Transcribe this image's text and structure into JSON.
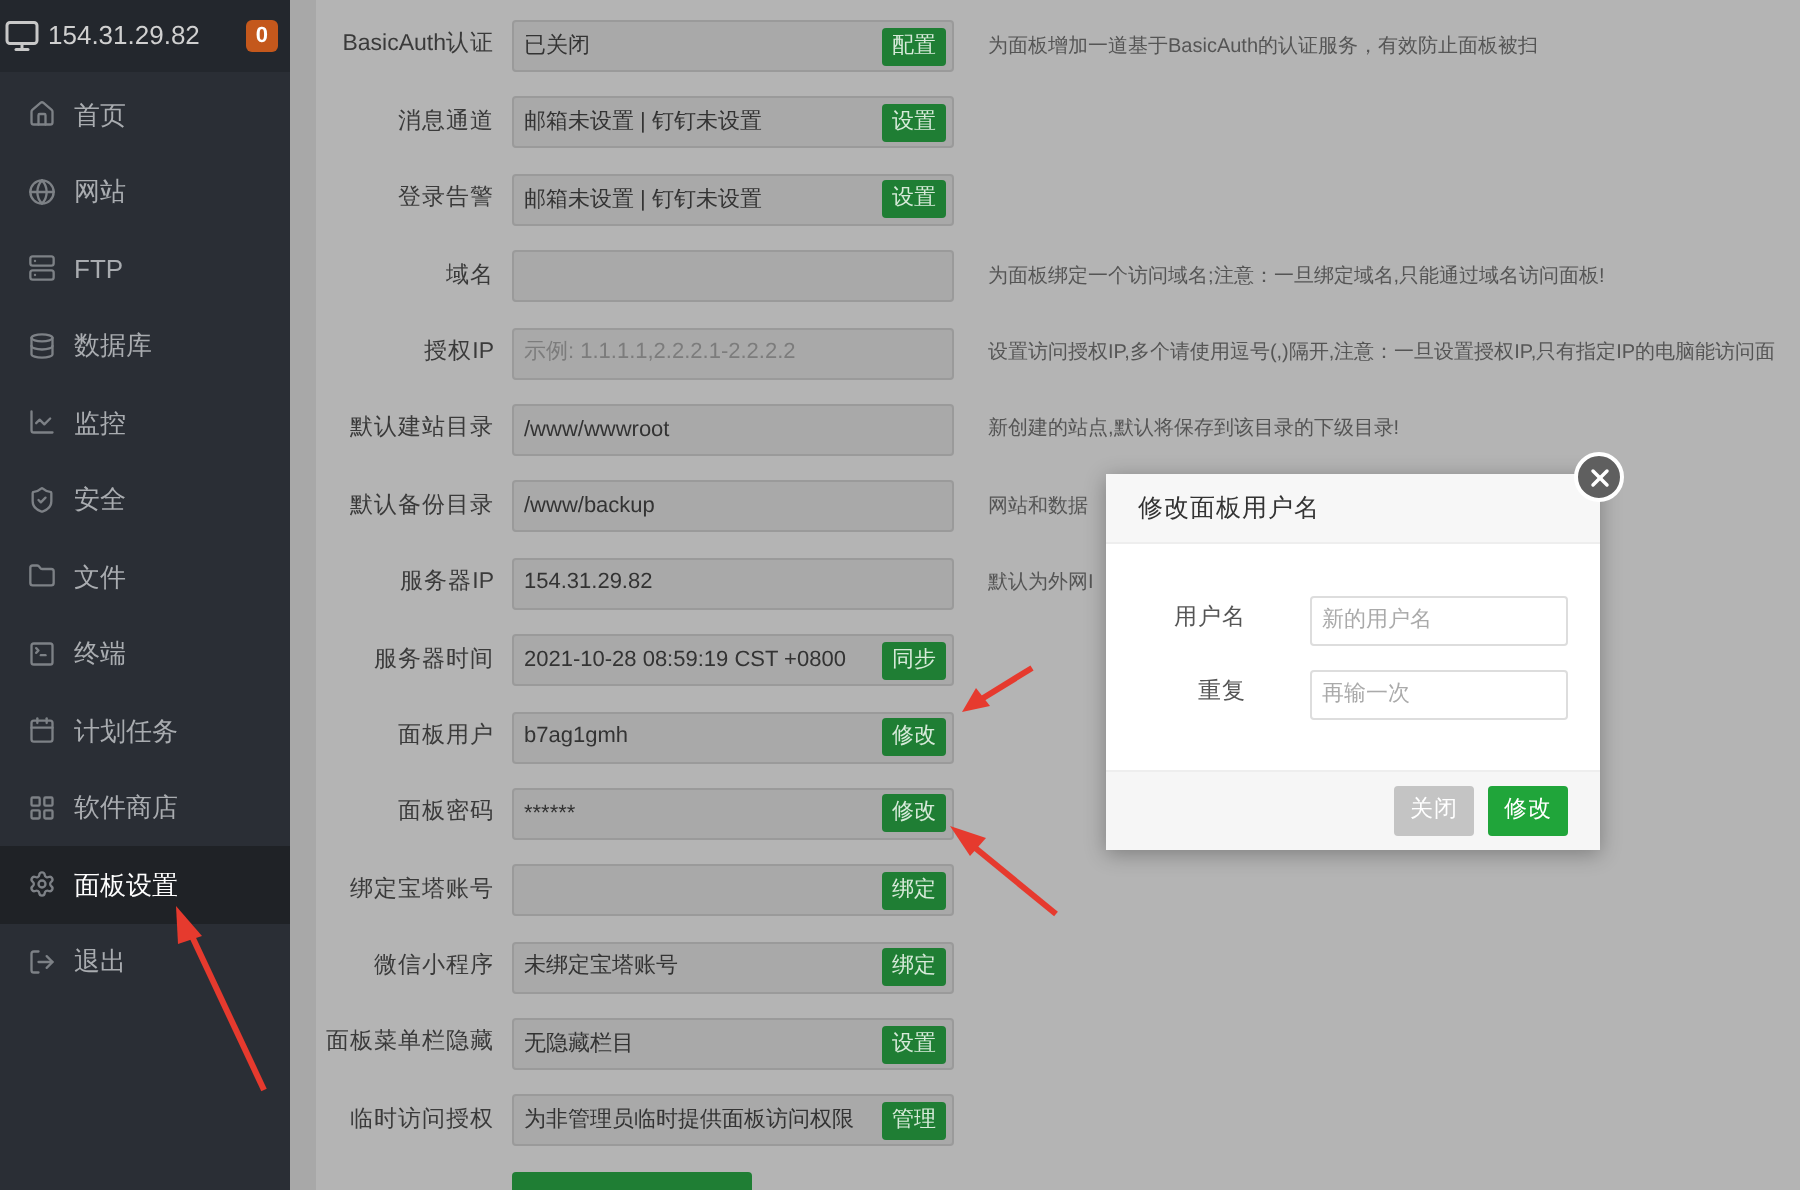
{
  "header": {
    "ip": "154.31.29.82",
    "badge": "0"
  },
  "sidebar": {
    "items": [
      {
        "label": "首页",
        "selected": false
      },
      {
        "label": "网站",
        "selected": false
      },
      {
        "label": "FTP",
        "selected": false
      },
      {
        "label": "数据库",
        "selected": false
      },
      {
        "label": "监控",
        "selected": false
      },
      {
        "label": "安全",
        "selected": false
      },
      {
        "label": "文件",
        "selected": false
      },
      {
        "label": "终端",
        "selected": false
      },
      {
        "label": "计划任务",
        "selected": false
      },
      {
        "label": "软件商店",
        "selected": false
      },
      {
        "label": "面板设置",
        "selected": true
      },
      {
        "label": "退出",
        "selected": false
      }
    ]
  },
  "settings": [
    {
      "label": "BasicAuth认证",
      "value": "已关闭",
      "button": "配置",
      "description": "为面板增加一道基于BasicAuth的认证服务，有效防止面板被扫"
    },
    {
      "label": "消息通道",
      "value": "邮箱未设置 | 钉钉未设置",
      "button": "设置"
    },
    {
      "label": "登录告警",
      "value": "邮箱未设置 | 钉钉未设置",
      "button": "设置"
    },
    {
      "label": "域名",
      "description": "为面板绑定一个访问域名;注意：一旦绑定域名,只能通过域名访问面板!"
    },
    {
      "label": "授权IP",
      "placeholder": "示例: 1.1.1.1,2.2.2.1-2.2.2.2",
      "description": "设置访问授权IP,多个请使用逗号(,)隔开,注意：一旦设置授权IP,只有指定IP的电脑能访问面"
    },
    {
      "label": "默认建站目录",
      "value": "/www/wwwroot",
      "description": "新创建的站点,默认将保存到该目录的下级目录!"
    },
    {
      "label": "默认备份目录",
      "value": "/www/backup",
      "description": "网站和数据"
    },
    {
      "label": "服务器IP",
      "value": "154.31.29.82",
      "description": "默认为外网I"
    },
    {
      "label": "服务器时间",
      "value": "2021-10-28 08:59:19 CST +0800",
      "button": "同步"
    },
    {
      "label": "面板用户",
      "value": "b7ag1gmh",
      "button": "修改"
    },
    {
      "label": "面板密码",
      "value": "******",
      "button": "修改"
    },
    {
      "label": "绑定宝塔账号",
      "button": "绑定"
    },
    {
      "label": "微信小程序",
      "value": "未绑定宝塔账号",
      "button": "绑定"
    },
    {
      "label": "面板菜单栏隐藏",
      "value": "无隐藏栏目",
      "button": "设置"
    },
    {
      "label": "临时访问授权",
      "value": "为非管理员临时提供面板访问权限",
      "button": "管理"
    }
  ],
  "modal": {
    "title": "修改面板用户名",
    "fields": [
      {
        "label": "用户名",
        "placeholder": "新的用户名"
      },
      {
        "label": "重复",
        "placeholder": "再输一次"
      }
    ],
    "buttons": [
      {
        "label": "关闭",
        "kind": "secondary"
      },
      {
        "label": "修改",
        "kind": "primary"
      }
    ]
  }
}
